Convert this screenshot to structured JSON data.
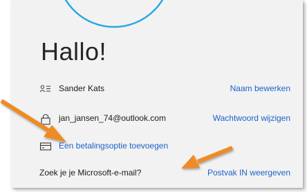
{
  "greeting": "Hallo!",
  "account": {
    "name": "Sander Kats",
    "edit_name_link": "Naam bewerken",
    "email": "jan_jansen_74@outlook.com",
    "change_password_link": "Wachtwoord wijzigen",
    "add_billing_link": "Een betalingsoptie toevoegen",
    "ms_email_question": "Zoek je je Microsoft-e-mail?",
    "view_inbox_link": "Postvak IN weergeven"
  },
  "icons": {
    "name": "contact-card-icon",
    "email": "lock-icon",
    "billing": "credit-card-icon"
  },
  "colors": {
    "link": "#1b62c8",
    "arrow": "#f08a24",
    "avatar_ring": "#29a8e0"
  }
}
